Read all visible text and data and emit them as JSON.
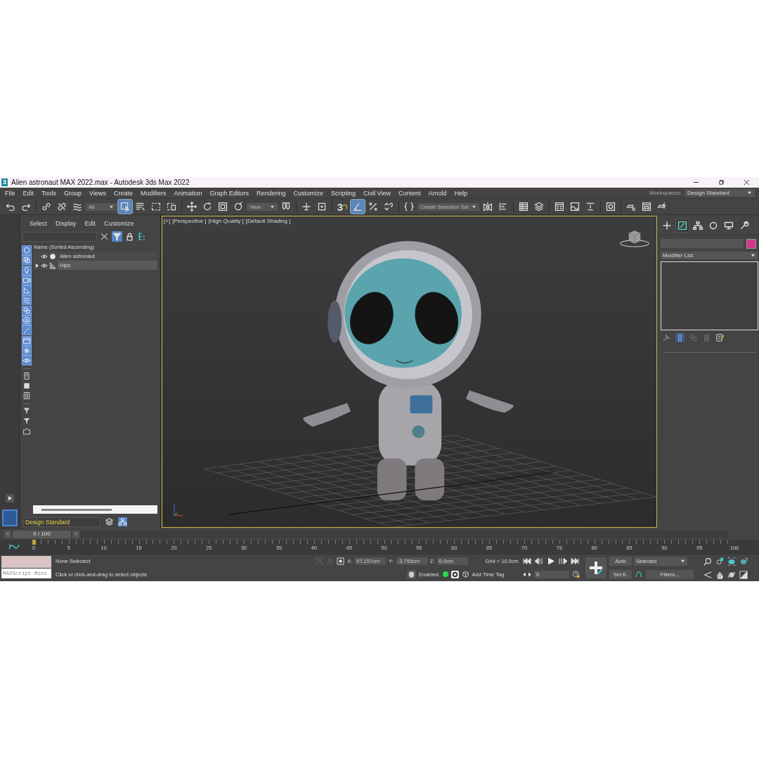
{
  "window": {
    "app_icon": "3",
    "title": "Alien astronaut MAX 2022.max - Autodesk 3ds Max 2022"
  },
  "menu": [
    "File",
    "Edit",
    "Tools",
    "Group",
    "Views",
    "Create",
    "Modifiers",
    "Animation",
    "Graph Editors",
    "Rendering",
    "Customize",
    "Scripting",
    "Civil View",
    "Content",
    "Arnold",
    "Help"
  ],
  "workspaces": {
    "label": "Workspaces:",
    "value": "Design Standard"
  },
  "toolbar": [
    {
      "kind": "undo",
      "selected": false
    },
    {
      "kind": "redo",
      "selected": false
    },
    {
      "kind": "separator"
    },
    {
      "kind": "link",
      "selected": false
    },
    {
      "kind": "unlink",
      "selected": false
    },
    {
      "kind": "bind",
      "selected": false
    },
    {
      "kind": "dropdown",
      "value": "All"
    },
    {
      "kind": "select",
      "selected": true
    },
    {
      "kind": "selectlist",
      "selected": false
    },
    {
      "kind": "rectregion",
      "selected": false
    },
    {
      "kind": "crossing",
      "selected": false
    },
    {
      "kind": "separator"
    },
    {
      "kind": "move",
      "selected": false
    },
    {
      "kind": "rotate",
      "selected": false
    },
    {
      "kind": "scale",
      "selected": false
    },
    {
      "kind": "placement",
      "selected": false
    },
    {
      "kind": "dropdown",
      "value": "View"
    },
    {
      "kind": "pivot",
      "selected": false
    },
    {
      "kind": "separator"
    },
    {
      "kind": "manipulate",
      "selected": false
    },
    {
      "kind": "keyboard",
      "selected": false
    },
    {
      "kind": "separator"
    },
    {
      "kind": "snap",
      "label": "3",
      "selected": false
    },
    {
      "kind": "anglesnap",
      "selected": true
    },
    {
      "kind": "percentsnap",
      "selected": false
    },
    {
      "kind": "spinnersnap",
      "selected": false
    },
    {
      "kind": "separator"
    },
    {
      "kind": "namedsets",
      "selected": false
    },
    {
      "kind": "dropdown",
      "value": "Create Selection Set"
    },
    {
      "kind": "mirror",
      "selected": false
    },
    {
      "kind": "align",
      "selected": false
    },
    {
      "kind": "separator"
    },
    {
      "kind": "explorer",
      "selected": false
    },
    {
      "kind": "layers",
      "selected": false
    },
    {
      "kind": "separator"
    },
    {
      "kind": "ribbon",
      "selected": false
    },
    {
      "kind": "curves",
      "selected": false
    },
    {
      "kind": "schematic",
      "selected": false
    },
    {
      "kind": "separator"
    },
    {
      "kind": "material",
      "selected": false
    },
    {
      "kind": "separator"
    },
    {
      "kind": "rendersetup",
      "selected": false
    },
    {
      "kind": "framewindow",
      "selected": false
    },
    {
      "kind": "render",
      "selected": false
    }
  ],
  "scene_explorer": {
    "menu": [
      "Select",
      "Display",
      "Edit",
      "Customize"
    ],
    "column_header": "Name (Sorted Ascending)",
    "filters": [
      {
        "on": true
      },
      {
        "on": true
      },
      {
        "on": true
      },
      {
        "on": true
      },
      {
        "on": true
      },
      {
        "on": true
      },
      {
        "on": true
      },
      {
        "on": true
      },
      {
        "on": true
      },
      {
        "on": true
      },
      {
        "on": true
      },
      {
        "on": true
      }
    ],
    "rows": [
      {
        "name": "Alien astronaut",
        "kind": "geometry",
        "highlighted": false
      },
      {
        "name": "Hips",
        "kind": "bone",
        "highlighted": true,
        "expanded": false
      }
    ],
    "layer_set": "Design Standard"
  },
  "viewport": {
    "labels": [
      "[+]",
      "[Perspective ]",
      "[High Quality ]",
      "[Default Shading ]"
    ]
  },
  "command_panel": {
    "tabs": [
      {
        "kind": "create",
        "selected": false
      },
      {
        "kind": "modify",
        "selected": true
      },
      {
        "kind": "hierarchy",
        "selected": false
      },
      {
        "kind": "motion",
        "selected": false
      },
      {
        "kind": "display",
        "selected": false
      },
      {
        "kind": "utilities",
        "selected": false
      }
    ],
    "modifier_list": "Modifier List"
  },
  "time_slider": {
    "prev": "<",
    "position": "0 / 100",
    "next": ">",
    "level": 0
  },
  "timeline": {
    "labels": [
      "0",
      "5",
      "10",
      "15",
      "20",
      "25",
      "30",
      "35",
      "40",
      "45",
      "50",
      "55",
      "60",
      "65",
      "70",
      "75",
      "80",
      "85",
      "90",
      "95",
      "100"
    ]
  },
  "status": {
    "maxscript": "MAXScript Mini",
    "selection": "None Selected",
    "prompt": "Click or click-and-drag to select objects",
    "x_label": "X:",
    "x": "97,157cm",
    "y_label": "Y:",
    "y": "-3,755cm",
    "z_label": "Z:",
    "z": "0,0cm",
    "grid": "Grid = 10,0cm",
    "enabled_label": "Enabled:",
    "enabled": true,
    "time_tag": "Add Time Tag"
  },
  "animation": {
    "auto": "Auto",
    "set_key": "Set K.",
    "key_filter": "Selected",
    "filters": "Filters...",
    "frame": "0"
  }
}
